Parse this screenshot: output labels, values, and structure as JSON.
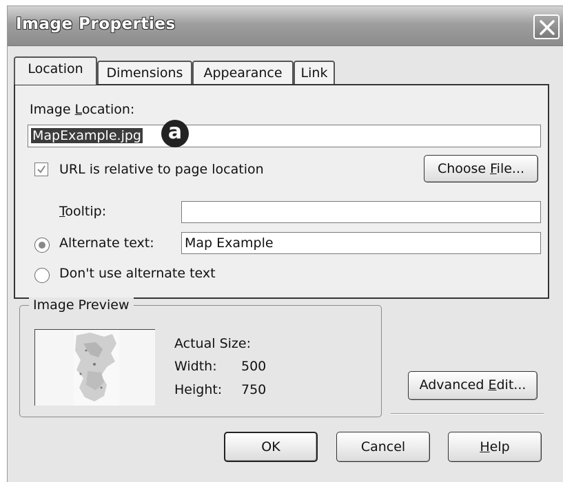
{
  "window": {
    "title": "Image Properties",
    "close_icon": "close-icon"
  },
  "tabs": [
    {
      "label": "Location",
      "active": true
    },
    {
      "label": "Dimensions",
      "active": false
    },
    {
      "label": "Appearance",
      "active": false
    },
    {
      "label": "Link",
      "active": false
    }
  ],
  "location": {
    "image_location_label_pre": "Image ",
    "image_location_label_u": "L",
    "image_location_label_post": "ocation:",
    "image_location_value": "MapExample.jpg",
    "callout": "a",
    "url_relative_label": "URL is relative to page location",
    "url_relative_checked": true,
    "choose_file_pre": "Choose ",
    "choose_file_u": "F",
    "choose_file_post": "ile...",
    "tooltip_u": "T",
    "tooltip_post": "ooltip:",
    "tooltip_value": "",
    "alt_text_label": "Alternate text:",
    "alt_text_value": "Map Example",
    "alt_text_selected": true,
    "no_alt_label": "Don't use alternate text"
  },
  "preview": {
    "group_title": "Image Preview",
    "actual_size_label": "Actual Size:",
    "width_label": "Width:",
    "width_value": "500",
    "height_label": "Height:",
    "height_value": "750"
  },
  "buttons": {
    "advanced_pre": "Advanced ",
    "advanced_u": "E",
    "advanced_post": "dit...",
    "ok": "OK",
    "cancel": "Cancel",
    "help_u": "H",
    "help_post": "elp"
  }
}
